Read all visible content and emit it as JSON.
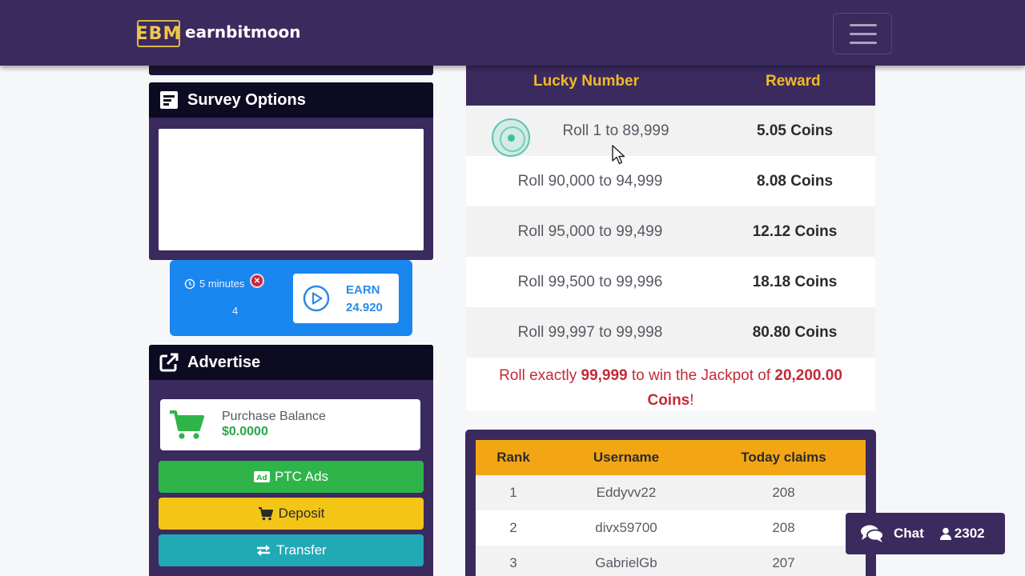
{
  "header": {
    "logo_text": "EBM",
    "brand": "earnbitmoon"
  },
  "sidebar": {
    "survey": {
      "title": "Survey Options"
    },
    "earn_widget": {
      "timer_label": "5 minutes",
      "count": "4",
      "earn_label": "EARN",
      "earn_amount": "24.920"
    },
    "advertise": {
      "title": "Advertise",
      "balance_label": "Purchase Balance",
      "balance_value": "$0.0000",
      "ptc_label": "PTC Ads",
      "deposit_label": "Deposit",
      "transfer_label": "Transfer"
    }
  },
  "rewards": {
    "headers": [
      "Lucky Number",
      "Reward"
    ],
    "rows": [
      {
        "range": "Roll 1 to 89,999",
        "reward": "5.05 Coins"
      },
      {
        "range": "Roll 90,000 to 94,999",
        "reward": "8.08 Coins"
      },
      {
        "range": "Roll 95,000 to 99,499",
        "reward": "12.12 Coins"
      },
      {
        "range": "Roll 99,500 to 99,996",
        "reward": "18.18 Coins"
      },
      {
        "range": "Roll 99,997 to 99,998",
        "reward": "80.80 Coins"
      }
    ],
    "jackpot": {
      "prefix": "Roll exactly ",
      "number": "99,999",
      "middle": " to win the Jackpot of ",
      "amount": "20,200.00",
      "coins": "Coins",
      "suffix": "!"
    }
  },
  "leaderboard": {
    "headers": [
      "Rank",
      "Username",
      "Today claims"
    ],
    "rows": [
      {
        "rank": "1",
        "username": "Eddyvv22",
        "claims": "208"
      },
      {
        "rank": "2",
        "username": "divx59700",
        "claims": "208"
      },
      {
        "rank": "3",
        "username": "GabrielGb",
        "claims": "207"
      }
    ]
  },
  "chat": {
    "label": "Chat",
    "online_count": "2302"
  },
  "colors": {
    "nav": "#3b2a5e",
    "panel_head": "#0d0b22",
    "gold": "#f2b92a",
    "green": "#2fb44a",
    "yellow": "#f2c517",
    "teal": "#22a9b6",
    "blue": "#1a86f0",
    "jackpot_red": "#c42a38"
  }
}
